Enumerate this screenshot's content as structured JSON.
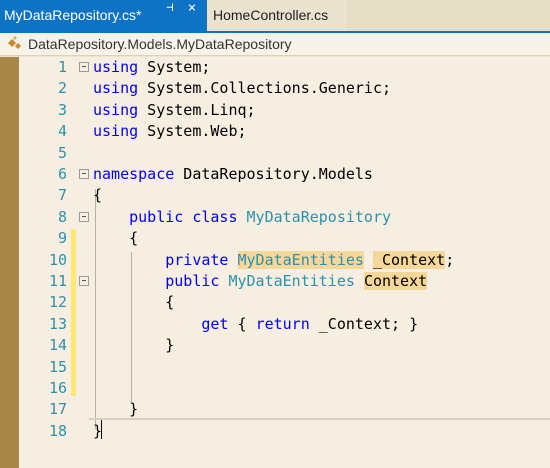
{
  "tabs": {
    "active_label": "MyDataRepository.cs*",
    "inactive_label": "HomeController.cs",
    "pin_glyph": "⊣",
    "close_glyph": "×"
  },
  "navbar": {
    "path": "DataRepository.Models.MyDataRepository",
    "icon": "class-icon"
  },
  "colors": {
    "accent": "#0e72c5",
    "keyword": "#0000ff",
    "type": "#2b91af",
    "highlight": "#f6d79a",
    "change_marker": "#fde874"
  },
  "lines": [
    {
      "n": "1",
      "tokens": [
        {
          "t": "using",
          "c": "kw"
        },
        {
          "t": " System;"
        }
      ]
    },
    {
      "n": "2",
      "tokens": [
        {
          "t": "using",
          "c": "kw"
        },
        {
          "t": " System.Collections.Generic;"
        }
      ]
    },
    {
      "n": "3",
      "tokens": [
        {
          "t": "using",
          "c": "kw"
        },
        {
          "t": " System.Linq;"
        }
      ]
    },
    {
      "n": "4",
      "tokens": [
        {
          "t": "using",
          "c": "kw"
        },
        {
          "t": " System.Web;"
        }
      ]
    },
    {
      "n": "5",
      "tokens": []
    },
    {
      "n": "6",
      "tokens": [
        {
          "t": "namespace",
          "c": "kw"
        },
        {
          "t": " DataRepository.Models"
        }
      ]
    },
    {
      "n": "7",
      "tokens": [
        {
          "t": "{"
        }
      ]
    },
    {
      "n": "8",
      "tokens": [
        {
          "t": "    "
        },
        {
          "t": "public",
          "c": "kw"
        },
        {
          "t": " "
        },
        {
          "t": "class",
          "c": "kw"
        },
        {
          "t": " "
        },
        {
          "t": "MyDataRepository",
          "c": "ty"
        }
      ]
    },
    {
      "n": "9",
      "tokens": [
        {
          "t": "    {"
        }
      ]
    },
    {
      "n": "10",
      "tokens": [
        {
          "t": "        "
        },
        {
          "t": "private",
          "c": "kw"
        },
        {
          "t": " "
        },
        {
          "t": "MyDataEntities",
          "c": "ty hl"
        },
        {
          "t": " "
        },
        {
          "t": "_Context",
          "c": "hl"
        },
        {
          "t": ";"
        }
      ]
    },
    {
      "n": "11",
      "tokens": [
        {
          "t": "        "
        },
        {
          "t": "public",
          "c": "kw"
        },
        {
          "t": " "
        },
        {
          "t": "MyDataEntities",
          "c": "ty"
        },
        {
          "t": " "
        },
        {
          "t": "Context",
          "c": "hl"
        }
      ]
    },
    {
      "n": "12",
      "tokens": [
        {
          "t": "        {"
        }
      ]
    },
    {
      "n": "13",
      "tokens": [
        {
          "t": "            "
        },
        {
          "t": "get",
          "c": "kw"
        },
        {
          "t": " { "
        },
        {
          "t": "return",
          "c": "kw"
        },
        {
          "t": " _Context; }"
        }
      ]
    },
    {
      "n": "14",
      "tokens": [
        {
          "t": "        }"
        }
      ]
    },
    {
      "n": "15",
      "tokens": []
    },
    {
      "n": "16",
      "tokens": []
    },
    {
      "n": "17",
      "tokens": [
        {
          "t": "    }"
        }
      ]
    },
    {
      "n": "18",
      "tokens": [
        {
          "t": "}"
        }
      ]
    }
  ]
}
